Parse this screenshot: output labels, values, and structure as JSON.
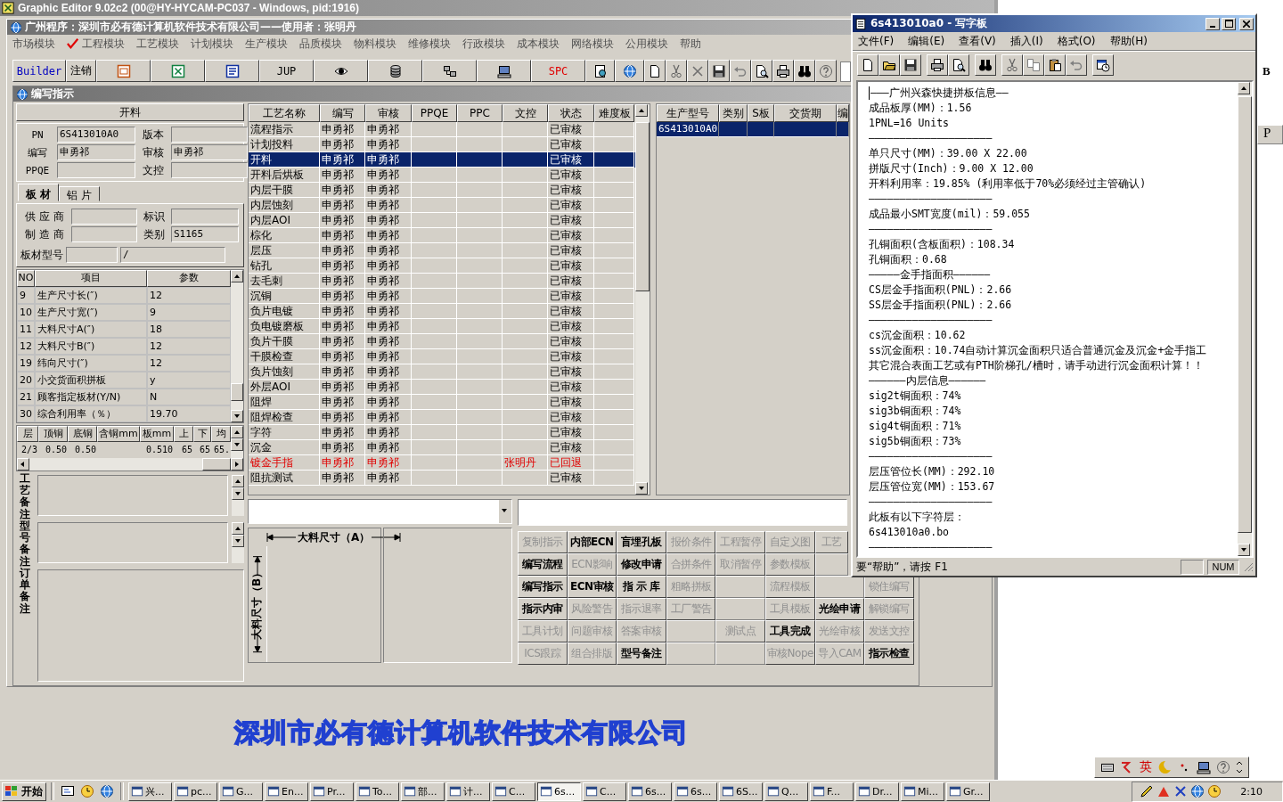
{
  "app_window": {
    "title": "Graphic Editor 9.02c2 (00@HY-HYCAM-PC037 - Windows, pid:1916)"
  },
  "mdi_window": {
    "title": "广州程序：深圳市必有德计算机软件技术有限公司——使用者：张明丹"
  },
  "module_menu": [
    {
      "label": "市场模块",
      "checked": false
    },
    {
      "label": "工程模块",
      "checked": true
    },
    {
      "label": "工艺模块",
      "checked": false
    },
    {
      "label": "计划模块",
      "checked": false
    },
    {
      "label": "生产模块",
      "checked": false
    },
    {
      "label": "品质模块",
      "checked": false
    },
    {
      "label": "物料模块",
      "checked": false
    },
    {
      "label": "维修模块",
      "checked": false
    },
    {
      "label": "行政模块",
      "checked": false
    },
    {
      "label": "成本模块",
      "checked": false
    },
    {
      "label": "网络模块",
      "checked": false
    },
    {
      "label": "公用模块",
      "checked": false
    },
    {
      "label": "帮助",
      "checked": false
    }
  ],
  "toolbar": [
    {
      "kind": "text",
      "label": "Builder",
      "color": "#0000c0"
    },
    {
      "kind": "text",
      "label": "注销",
      "color": "#000000"
    },
    {
      "kind": "slides"
    },
    {
      "kind": "sheet"
    },
    {
      "kind": "doc"
    },
    {
      "kind": "text",
      "label": "JUP",
      "color": "#000000"
    },
    {
      "kind": "eye"
    },
    {
      "kind": "db"
    },
    {
      "kind": "net"
    },
    {
      "kind": "pc"
    },
    {
      "kind": "text",
      "label": "SPC",
      "color": "#e00000"
    }
  ],
  "toolbar_small": [
    {
      "kind": "geardoc"
    },
    {
      "kind": "globe"
    },
    {
      "kind": "new"
    },
    {
      "kind": "cut"
    },
    {
      "kind": "delete"
    },
    {
      "kind": "save"
    },
    {
      "kind": "undo"
    },
    {
      "kind": "preview"
    },
    {
      "kind": "print"
    },
    {
      "kind": "find"
    },
    {
      "kind": "help"
    }
  ],
  "child_window": {
    "title": "编写指示"
  },
  "step_panel": {
    "title": "开料",
    "fields": [
      {
        "label": "PN",
        "value": "6S413010A0"
      },
      {
        "label": "版本"
      },
      {
        "label": "编写",
        "value": "申勇祁"
      },
      {
        "label": "审核",
        "value": "申勇祁"
      },
      {
        "label": "PPQE"
      },
      {
        "label": "文控"
      }
    ]
  },
  "material_tabs": [
    {
      "label": "板 材",
      "selected": true
    },
    {
      "label": "铝 片",
      "selected": false
    }
  ],
  "material_fields": [
    {
      "label": "供 应 商"
    },
    {
      "label": "标识"
    },
    {
      "label": "制 造 商"
    },
    {
      "label": "类别",
      "value": "S1165"
    }
  ],
  "board_model": {
    "label": "板材型号",
    "value_2": "/"
  },
  "params": {
    "columns": [
      "NO",
      "项目",
      "参数"
    ],
    "rows": [
      [
        "9",
        "生产尺寸长(″)",
        "12"
      ],
      [
        "10",
        "生产尺寸宽(″)",
        "9"
      ],
      [
        "11",
        "大料尺寸A(″)",
        "18"
      ],
      [
        "12",
        "大料尺寸B(″)",
        "12"
      ],
      [
        "19",
        "纬向尺寸(″)",
        "12"
      ],
      [
        "20",
        "小交货面积拼板",
        "y"
      ],
      [
        "21",
        "顾客指定板材(Y/N)",
        "N"
      ],
      [
        "30",
        "综合利用率（％）",
        "19.70"
      ]
    ]
  },
  "layers": {
    "columns": [
      "层",
      "顶铜",
      "底铜",
      "含铜mm",
      "板mm",
      "上",
      "下",
      "均"
    ],
    "rows": [
      [
        "2/3",
        "0.50",
        "0.50",
        null,
        "0.510",
        "65",
        "65",
        "65."
      ]
    ]
  },
  "memos": [
    {
      "label": "工艺备注"
    },
    {
      "label": "型号备注"
    },
    {
      "label": "订单备注"
    }
  ],
  "process_table": {
    "columns": [
      "工艺名称",
      "编写",
      "审核",
      "PPQE",
      "PPC",
      "文控",
      "状态",
      "难度板"
    ],
    "rows": [
      {
        "cells": [
          "流程指示",
          "申勇祁",
          "申勇祁",
          null,
          null,
          null,
          "已审核",
          null
        ],
        "selected": false,
        "returned": false
      },
      {
        "cells": [
          "计划投料",
          "申勇祁",
          "申勇祁",
          null,
          null,
          null,
          "已审核",
          null
        ],
        "selected": false,
        "returned": false
      },
      {
        "cells": [
          "开料",
          "申勇祁",
          "申勇祁",
          null,
          null,
          null,
          "已审核",
          null
        ],
        "selected": true,
        "returned": false
      },
      {
        "cells": [
          "开料后烘板",
          "申勇祁",
          "申勇祁",
          null,
          null,
          null,
          "已审核",
          null
        ],
        "selected": false,
        "returned": false
      },
      {
        "cells": [
          "内层干膜",
          "申勇祁",
          "申勇祁",
          null,
          null,
          null,
          "已审核",
          null
        ],
        "selected": false,
        "returned": false
      },
      {
        "cells": [
          "内层蚀刻",
          "申勇祁",
          "申勇祁",
          null,
          null,
          null,
          "已审核",
          null
        ],
        "selected": false,
        "returned": false
      },
      {
        "cells": [
          "内层AOI",
          "申勇祁",
          "申勇祁",
          null,
          null,
          null,
          "已审核",
          null
        ],
        "selected": false,
        "returned": false
      },
      {
        "cells": [
          "棕化",
          "申勇祁",
          "申勇祁",
          null,
          null,
          null,
          "已审核",
          null
        ],
        "selected": false,
        "returned": false
      },
      {
        "cells": [
          "层压",
          "申勇祁",
          "申勇祁",
          null,
          null,
          null,
          "已审核",
          null
        ],
        "selected": false,
        "returned": false
      },
      {
        "cells": [
          "钻孔",
          "申勇祁",
          "申勇祁",
          null,
          null,
          null,
          "已审核",
          null
        ],
        "selected": false,
        "returned": false
      },
      {
        "cells": [
          "去毛刺",
          "申勇祁",
          "申勇祁",
          null,
          null,
          null,
          "已审核",
          null
        ],
        "selected": false,
        "returned": false
      },
      {
        "cells": [
          "沉铜",
          "申勇祁",
          "申勇祁",
          null,
          null,
          null,
          "已审核",
          null
        ],
        "selected": false,
        "returned": false
      },
      {
        "cells": [
          "负片电镀",
          "申勇祁",
          "申勇祁",
          null,
          null,
          null,
          "已审核",
          null
        ],
        "selected": false,
        "returned": false
      },
      {
        "cells": [
          "负电镀磨板",
          "申勇祁",
          "申勇祁",
          null,
          null,
          null,
          "已审核",
          null
        ],
        "selected": false,
        "returned": false
      },
      {
        "cells": [
          "负片干膜",
          "申勇祁",
          "申勇祁",
          null,
          null,
          null,
          "已审核",
          null
        ],
        "selected": false,
        "returned": false
      },
      {
        "cells": [
          "干膜检查",
          "申勇祁",
          "申勇祁",
          null,
          null,
          null,
          "已审核",
          null
        ],
        "selected": false,
        "returned": false
      },
      {
        "cells": [
          "负片蚀刻",
          "申勇祁",
          "申勇祁",
          null,
          null,
          null,
          "已审核",
          null
        ],
        "selected": false,
        "returned": false
      },
      {
        "cells": [
          "外层AOI",
          "申勇祁",
          "申勇祁",
          null,
          null,
          null,
          "已审核",
          null
        ],
        "selected": false,
        "returned": false
      },
      {
        "cells": [
          "阻焊",
          "申勇祁",
          "申勇祁",
          null,
          null,
          null,
          "已审核",
          null
        ],
        "selected": false,
        "returned": false
      },
      {
        "cells": [
          "阻焊检查",
          "申勇祁",
          "申勇祁",
          null,
          null,
          null,
          "已审核",
          null
        ],
        "selected": false,
        "returned": false
      },
      {
        "cells": [
          "字符",
          "申勇祁",
          "申勇祁",
          null,
          null,
          null,
          "已审核",
          null
        ],
        "selected": false,
        "returned": false
      },
      {
        "cells": [
          "沉金",
          "申勇祁",
          "申勇祁",
          null,
          null,
          null,
          "已审核",
          null
        ],
        "selected": false,
        "returned": false
      },
      {
        "cells": [
          "镀金手指",
          "申勇祁",
          "申勇祁",
          null,
          null,
          "张明丹",
          "已回退",
          null
        ],
        "selected": false,
        "returned": true
      },
      {
        "cells": [
          "阻抗测试",
          "申勇祁",
          "申勇祁",
          null,
          null,
          null,
          "已审核",
          null
        ],
        "selected": false,
        "returned": false
      }
    ]
  },
  "order_table": {
    "columns": [
      "生产型号",
      "类别",
      "S板",
      "交货期",
      "编"
    ],
    "rows": [
      {
        "cells": [
          "6S413010A0",
          null,
          null,
          null,
          null
        ],
        "selected": true
      }
    ]
  },
  "size_diagram": {
    "width_label": "大料尺寸（A）",
    "height_label": "大料尺寸（B）"
  },
  "actions": [
    [
      {
        "label": "复制指示",
        "enabled": false
      },
      {
        "label": "内部ECN",
        "enabled": true
      },
      {
        "label": "盲埋孔板",
        "enabled": true
      },
      {
        "label": "报价条件",
        "enabled": false
      },
      {
        "label": "工程暂停",
        "enabled": false
      },
      {
        "label": "自定义图",
        "enabled": false
      },
      {
        "label": "工艺",
        "enabled": false
      }
    ],
    [
      {
        "label": "编写流程",
        "enabled": true
      },
      {
        "label": "ECN影响",
        "enabled": false
      },
      {
        "label": "修改申请",
        "enabled": true
      },
      {
        "label": "合拼条件",
        "enabled": false
      },
      {
        "label": "取消暂停",
        "enabled": false
      },
      {
        "label": "参数模板",
        "enabled": false
      },
      {
        "kind": "blank"
      }
    ],
    [
      {
        "label": "编写指示",
        "enabled": true
      },
      {
        "label": "ECN审核",
        "enabled": true
      },
      {
        "label": "指 示 库",
        "enabled": true
      },
      {
        "label": "粗略拼板",
        "enabled": false
      },
      {
        "kind": "blank"
      },
      {
        "label": "流程模板",
        "enabled": false
      },
      {
        "kind": "blank"
      },
      {
        "label": "锁住编写",
        "enabled": false
      }
    ],
    [
      {
        "label": "指示内审",
        "enabled": true
      },
      {
        "label": "风险警告",
        "enabled": false
      },
      {
        "label": "指示退率",
        "enabled": false
      },
      {
        "label": "工厂警告",
        "enabled": false
      },
      {
        "kind": "blank"
      },
      {
        "label": "工具模板",
        "enabled": false
      },
      {
        "label": "光绘申请",
        "enabled": true
      },
      {
        "label": "解锁编写",
        "enabled": false
      }
    ],
    [
      {
        "label": "工具计划",
        "enabled": false
      },
      {
        "label": "问题审核",
        "enabled": false
      },
      {
        "label": "答案审核",
        "enabled": false
      },
      {
        "kind": "blank"
      },
      {
        "label": "测试点",
        "enabled": false
      },
      {
        "label": "工具完成",
        "enabled": true
      },
      {
        "label": "光绘审核",
        "enabled": false
      },
      {
        "label": "发送文控",
        "enabled": false
      }
    ],
    [
      {
        "label": "ICS跟踪",
        "enabled": false
      },
      {
        "label": "组合排版",
        "enabled": false
      },
      {
        "label": "型号备注",
        "enabled": true
      },
      {
        "kind": "blank"
      },
      {
        "kind": "blank"
      },
      {
        "label": "审核Nope",
        "enabled": false
      },
      {
        "label": "导入CAM",
        "enabled": false
      },
      {
        "label": "指示检查",
        "enabled": true
      }
    ]
  ],
  "banner": "深圳市必有德计算机软件技术有限公司",
  "notepad": {
    "title": "6s413010a0 - 写字板",
    "menu": [
      "文件(F)",
      "编辑(E)",
      "查看(V)",
      "插入(I)",
      "格式(O)",
      "帮助(H)"
    ],
    "toolbar": [
      {
        "kind": "new"
      },
      {
        "kind": "open"
      },
      {
        "kind": "save"
      },
      {
        "kind": "separator"
      },
      {
        "kind": "print"
      },
      {
        "kind": "preview"
      },
      {
        "kind": "separator"
      },
      {
        "kind": "find"
      },
      {
        "kind": "separator"
      },
      {
        "kind": "cut"
      },
      {
        "kind": "copy"
      },
      {
        "kind": "paste"
      },
      {
        "kind": "undo"
      },
      {
        "kind": "separator"
      },
      {
        "kind": "datetime"
      }
    ],
    "lines": [
      "———广州兴森快捷拼板信息——",
      "成品板厚(MM)：1.56",
      "1PNL=16 Units",
      "————————————————————",
      "单只尺寸(MM)：39.00 X 22.00",
      "拼版尺寸(Inch)：9.00 X 12.00",
      "开料利用率：19.85% (利用率低于70%必须经过主管确认)",
      "————————————————————",
      "成品最小SMT宽度(mil)：59.055",
      "————————————————————",
      "孔铜面积(含板面积)：108.34",
      "孔铜面积：0.68",
      "—————金手指面积——————",
      "CS层金手指面积(PNL)：2.66",
      "SS层金手指面积(PNL)：2.66",
      "————————————————————",
      "cs沉金面积：10.62",
      "ss沉金面积：10.74自动计算沉金面积只适合普通沉金及沉金+金手指工",
      "其它混合表面工艺或有PTH阶梯孔/槽时，请手动进行沉金面积计算！！",
      "——————内层信息——————",
      "sig2t铜面积：74%",
      "sig3b铜面积：74%",
      "sig4t铜面积：71%",
      "sig5b铜面积：73%",
      "————————————————————",
      "层压管位长(MM)：292.10",
      "层压管位宽(MM)：153.67",
      "————————————————————",
      "此板有以下字符层：",
      "6s413010a0.bo",
      "————————————————————"
    ],
    "status": "要“帮助”，请按 F1",
    "indicator": "NUM"
  },
  "side_labels": [
    "B",
    "P"
  ],
  "language_bar": {
    "mode": "英"
  },
  "taskbar": {
    "start": "开始",
    "tasks": [
      {
        "label": "兴...",
        "selected": false
      },
      {
        "label": "pc...",
        "selected": false
      },
      {
        "label": "G...",
        "selected": false
      },
      {
        "label": "En...",
        "selected": false
      },
      {
        "label": "Pr...",
        "selected": false
      },
      {
        "label": "To...",
        "selected": false
      },
      {
        "label": "部...",
        "selected": false
      },
      {
        "label": "计...",
        "selected": false
      },
      {
        "label": "C...",
        "selected": false
      },
      {
        "label": "6s...",
        "selected": true
      },
      {
        "label": "C...",
        "selected": false
      },
      {
        "label": "6s...",
        "selected": false
      },
      {
        "label": "6s...",
        "selected": false
      },
      {
        "label": "6S...",
        "selected": false
      },
      {
        "label": "Q...",
        "selected": false
      },
      {
        "label": "F...",
        "selected": false
      },
      {
        "label": "Dr...",
        "selected": false
      },
      {
        "label": "Mi...",
        "selected": false
      },
      {
        "label": "Gr...",
        "selected": false
      }
    ],
    "clock": "2:10"
  }
}
